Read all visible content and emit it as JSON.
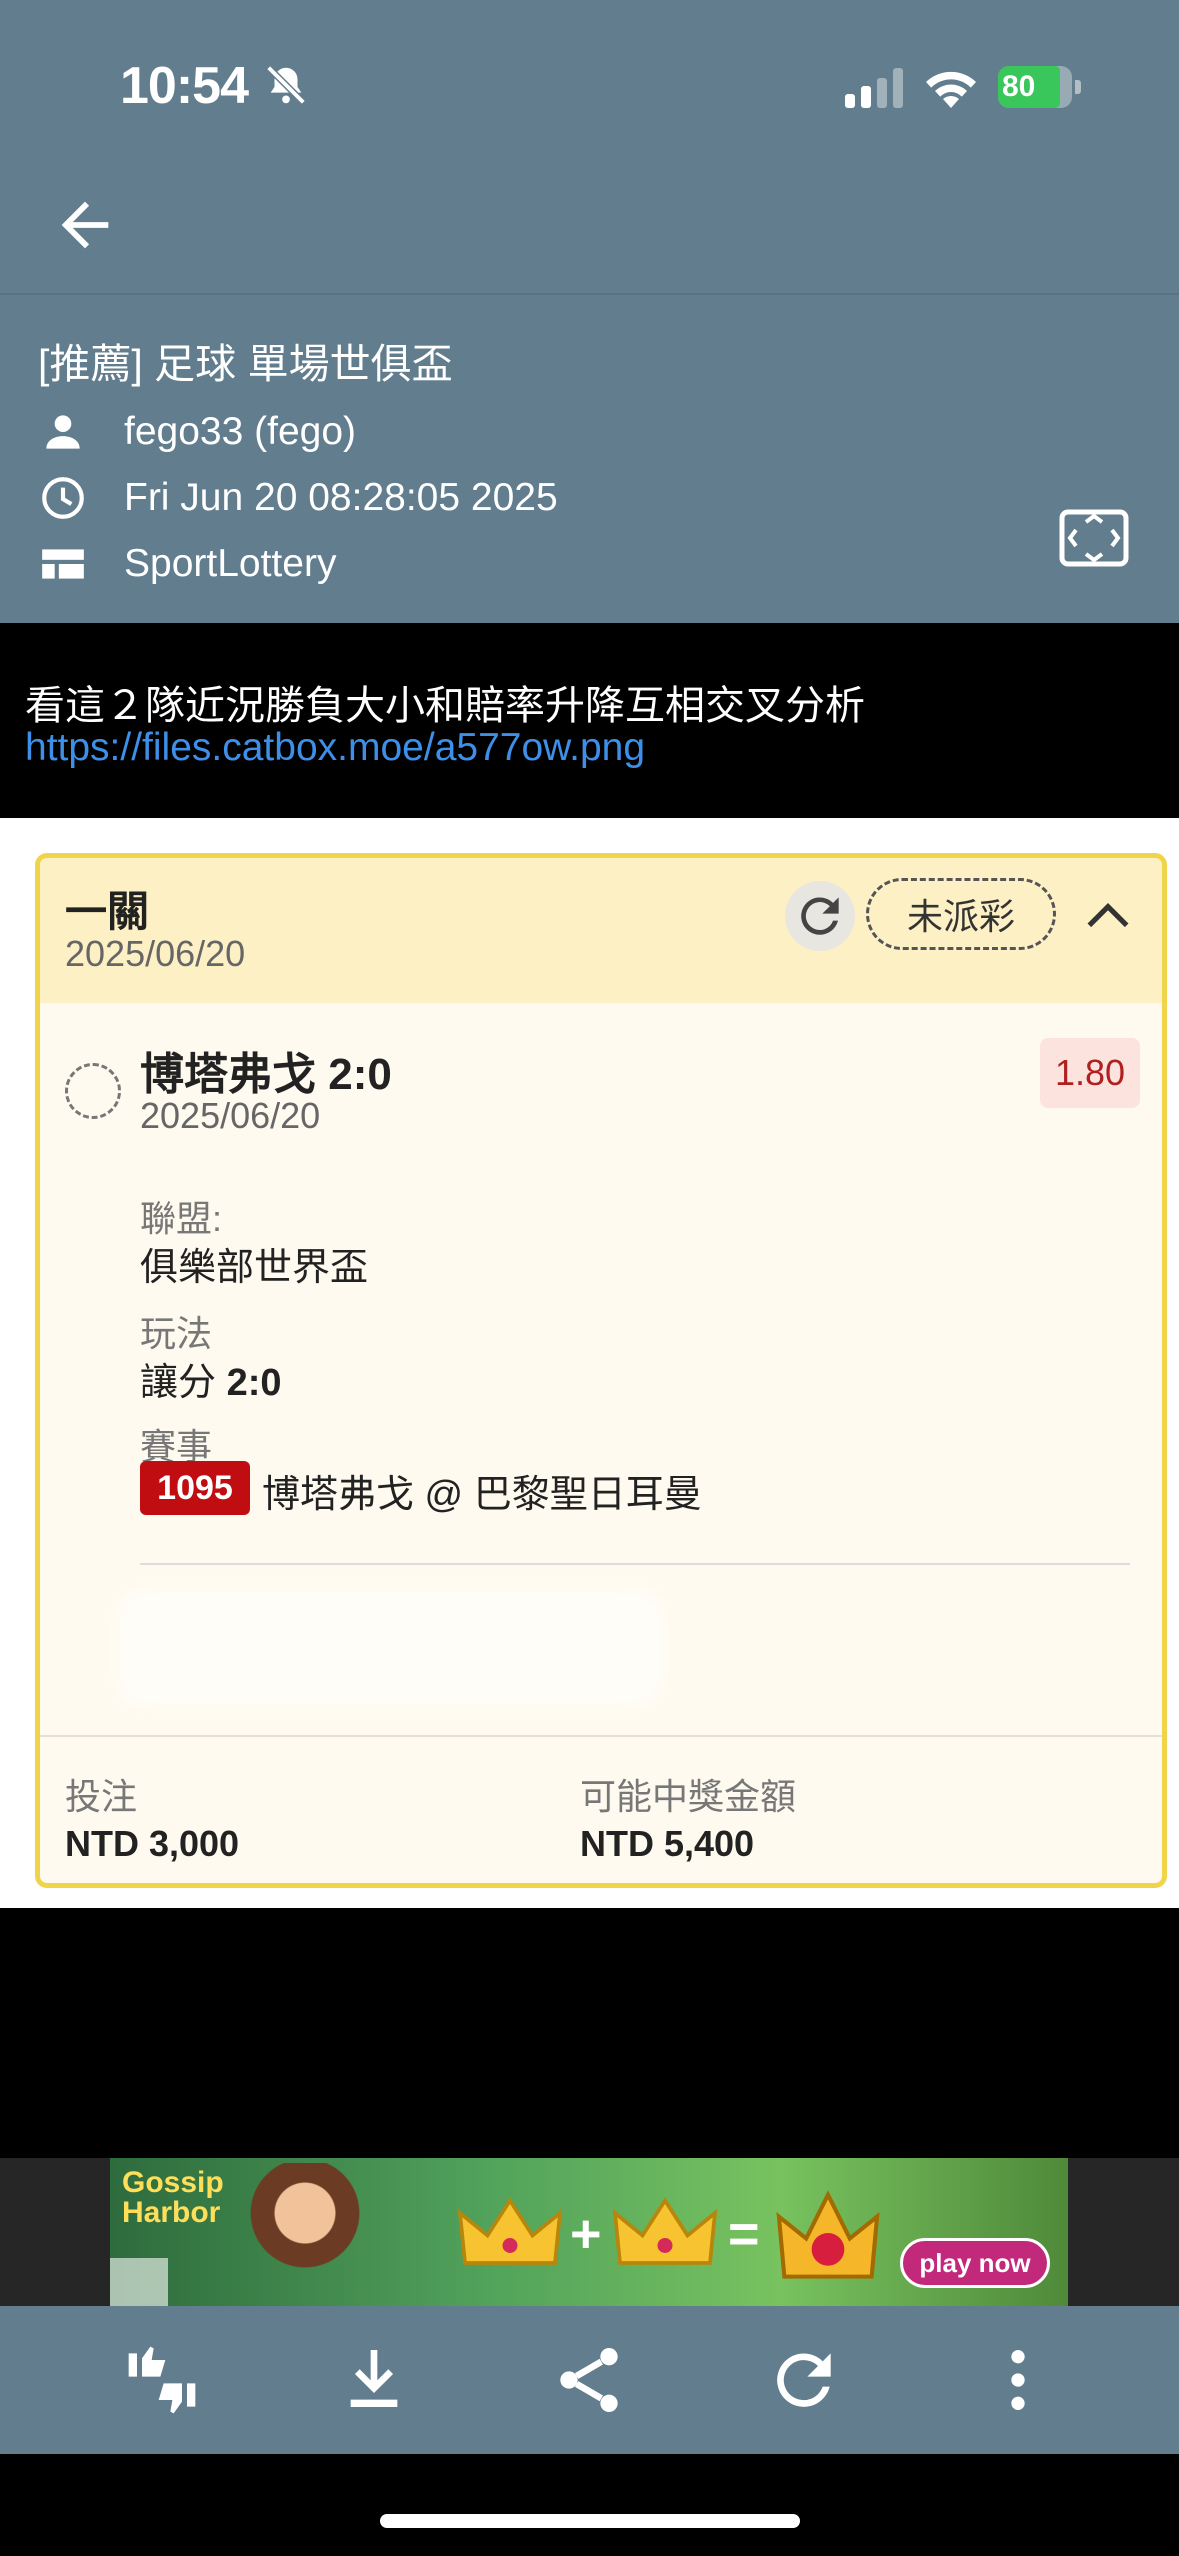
{
  "status_bar": {
    "time": "10:54",
    "battery": "80",
    "icons": [
      "bell-off-icon",
      "signal-icon",
      "wifi-icon",
      "battery-charging-icon"
    ]
  },
  "header": {
    "back_icon": "arrow-left-icon"
  },
  "post": {
    "title": "[推薦] 足球 單場世俱盃",
    "author": "fego33 (fego)",
    "datetime": "Fri Jun 20 08:28:05 2025",
    "board": "SportLottery",
    "body_line": "看這２隊近況勝負大小和賠率升降互相交叉分析",
    "link": "https://files.catbox.moe/a577ow.png"
  },
  "ticket": {
    "type": "一關",
    "date": "2025/06/20",
    "status": "未派彩",
    "selection": {
      "title": "博塔弗戈 2:0",
      "date": "2025/06/20",
      "odds": "1.80",
      "league_label": "聯盟:",
      "league_value": "俱樂部世界盃",
      "play_label": "玩法",
      "play_type": "讓分 ",
      "play_value": "2:0",
      "match_label": "賽事",
      "match_no": "1095",
      "match_name": "博塔弗戈 @ 巴黎聖日耳曼"
    },
    "stake_label": "投注",
    "stake_value": "NTD 3,000",
    "payout_label": "可能中獎金額",
    "payout_value": "NTD 5,400"
  },
  "ad": {
    "brand_line1": "Gossip",
    "brand_line2": "Harbor",
    "plus": "+",
    "equals": "=",
    "cta": "play now"
  },
  "toolbar": {
    "icons": [
      "thumbs-up-down-icon",
      "download-icon",
      "share-icon",
      "refresh-icon",
      "more-vertical-icon"
    ]
  },
  "colors": {
    "header_bg": "#627d8d",
    "link": "#3d8fe8",
    "ticket_border": "#f0d44a",
    "ticket_header": "#fcf0c4",
    "event_badge": "#c00d12",
    "battery_green": "#39c65a"
  }
}
